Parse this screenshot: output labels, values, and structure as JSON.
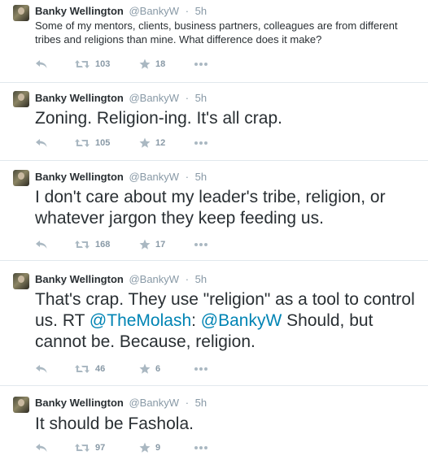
{
  "tweets": [
    {
      "name": "Banky Wellington",
      "handle": "@BankyW",
      "separator": "·",
      "time": "5h",
      "text_parts": [
        {
          "t": "Some of my mentors, clients, business partners, colleagues are from different tribes and religions than mine. What difference does it make?",
          "mention": false
        }
      ],
      "retweets": "103",
      "favorites": "18"
    },
    {
      "name": "Banky Wellington",
      "handle": "@BankyW",
      "separator": "·",
      "time": "5h",
      "text_parts": [
        {
          "t": "Zoning. Religion-ing. It's all crap.",
          "mention": false
        }
      ],
      "retweets": "105",
      "favorites": "12"
    },
    {
      "name": "Banky Wellington",
      "handle": "@BankyW",
      "separator": "·",
      "time": "5h",
      "text_parts": [
        {
          "t": "I don't care about my leader's tribe, religion, or whatever jargon they keep feeding us.",
          "mention": false
        }
      ],
      "retweets": "168",
      "favorites": "17"
    },
    {
      "name": "Banky Wellington",
      "handle": "@BankyW",
      "separator": "·",
      "time": "5h",
      "text_parts": [
        {
          "t": "That's crap. They use \"religion\" as a tool to control us. RT ",
          "mention": false
        },
        {
          "t": "@TheMolash",
          "mention": true
        },
        {
          "t": ": ",
          "mention": false
        },
        {
          "t": "@BankyW",
          "mention": true
        },
        {
          "t": " Should, but cannot be. Because, religion.",
          "mention": false
        }
      ],
      "retweets": "46",
      "favorites": "6"
    },
    {
      "name": "Banky Wellington",
      "handle": "@BankyW",
      "separator": "·",
      "time": "5h",
      "text_parts": [
        {
          "t": "It should be Fashola.",
          "mention": false
        }
      ],
      "retweets": "97",
      "favorites": "9"
    }
  ],
  "colors": {
    "name": "#292f33",
    "muted": "#8899a6",
    "mention": "#0084b4",
    "divider": "#e1e8ed"
  },
  "icons": {
    "reply": "reply-icon",
    "retweet": "retweet-icon",
    "favorite": "star-icon",
    "more": "more-icon"
  }
}
